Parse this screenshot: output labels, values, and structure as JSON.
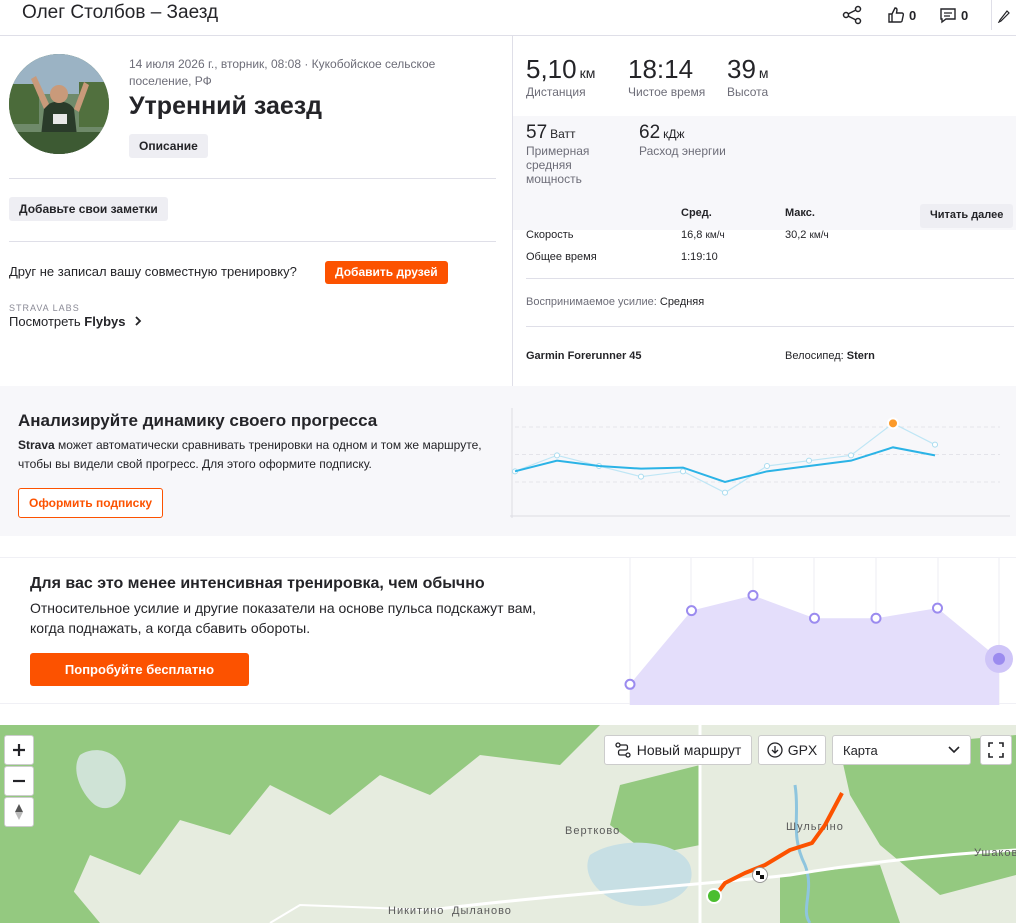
{
  "header": {
    "title": "Олег Столбов – Заезд",
    "kudos": "0",
    "comments": "0"
  },
  "left": {
    "meta": "14 июля 2026 г., вторник, 08:08 · Кукобойское сельское поселение, РФ",
    "title": "Утренний заезд",
    "description_label": "Описание",
    "notes_label": "Добавьте свои заметки",
    "friend_prompt": "Друг не записал вашу совместную тренировку?",
    "add_friends_label": "Добавить друзей",
    "labs_label": "STRAVA LABS",
    "flybys_prefix": "Посмотреть ",
    "flybys_bold": "Flybys"
  },
  "stats": {
    "distance": {
      "value": "5,10",
      "unit": "км",
      "label": "Дистанция"
    },
    "moving_time": {
      "value": "18:14",
      "label": "Чистое время"
    },
    "elevation": {
      "value": "39",
      "unit": "м",
      "label": "Высота"
    },
    "power": {
      "value": "57",
      "unit": "Ватт",
      "label": "Примерная средняя мощность"
    },
    "energy": {
      "value": "62",
      "unit": "кДж",
      "label": "Расход энергии"
    }
  },
  "details": {
    "col_avg": "Сред.",
    "col_max": "Макс.",
    "read_more": "Читать далее",
    "speed_label": "Скорость",
    "speed_avg": "16,8",
    "speed_avg_unit": "км/ч",
    "speed_max": "30,2",
    "speed_max_unit": "км/ч",
    "total_time_label": "Общее время",
    "total_time": "1:19:10",
    "effort_label": "Воспринимаемое усилие:",
    "effort_value": "Средняя",
    "device": "Garmin Forerunner 45",
    "bike_label": "Велосипед:",
    "bike_value": "Stern"
  },
  "progress_banner": {
    "title": "Анализируйте динамику своего прогресса",
    "text_bold": "Strava",
    "text": " может автоматически сравнивать тренировки на одном и том же маршруте, чтобы вы видели свой прогресс. Для этого оформите подписку.",
    "button": "Оформить подписку",
    "series": {
      "main": [
        2,
        4,
        3,
        2.5,
        2.7,
        0,
        2,
        3,
        4,
        6.5,
        5
      ],
      "ghost": [
        2,
        5,
        3,
        1,
        2,
        -2,
        3,
        4,
        5,
        11,
        7
      ]
    }
  },
  "effort_banner": {
    "title": "Для вас это менее интенсивная тренировка, чем обычно",
    "text": "Относительное усилие и другие показатели на основе пульса подскажут вам, когда поднажать, а когда сбавить обороты.",
    "button": "Попробуйте бесплатно",
    "points": [
      1,
      6.8,
      8,
      6.2,
      6.2,
      7,
      3
    ]
  },
  "map": {
    "new_route": "Новый маршрут",
    "gpx": "GPX",
    "map_type": "Карта",
    "labels": [
      "Вертково",
      "Шульгино",
      "Ушаково",
      "Никитино",
      "Дыланово"
    ],
    "colors": {
      "route": "#fc5200",
      "forest": "#8fc77b",
      "field": "#dfe9d7",
      "water": "#a9d3e5"
    }
  },
  "colors": {
    "accent": "#fc5200",
    "line_blue": "#2bb3e6",
    "purple": "#9b8bef"
  }
}
